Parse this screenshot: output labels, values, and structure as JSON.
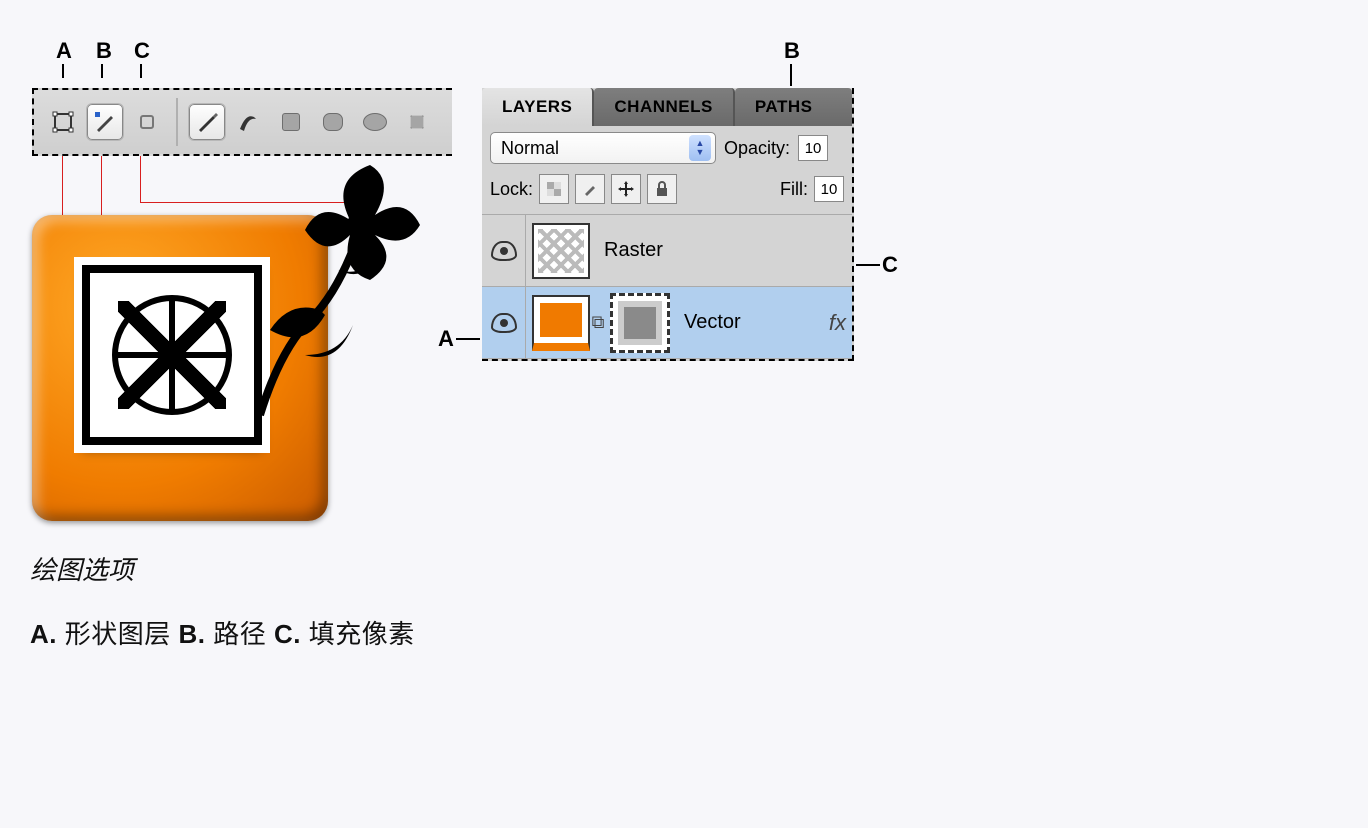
{
  "callouts": {
    "toolbar": {
      "a": "A",
      "b": "B",
      "c": "C"
    },
    "panel": {
      "a": "A",
      "b": "B",
      "c": "C"
    }
  },
  "toolbar": {
    "mode_a": "shape-layers-icon",
    "mode_b": "paths-icon",
    "mode_c": "fill-pixels-icon"
  },
  "panel": {
    "tabs": {
      "layers": "LAYERS",
      "channels": "CHANNELS",
      "paths": "PATHS"
    },
    "blend_mode": "Normal",
    "opacity_label": "Opacity:",
    "opacity_value": "10",
    "lock_label": "Lock:",
    "fill_label": "Fill:",
    "fill_value": "10",
    "layers": [
      {
        "name": "Raster",
        "selected": false,
        "kind": "raster"
      },
      {
        "name": "Vector",
        "selected": true,
        "kind": "vector",
        "has_fx": true,
        "fx_text": "fx"
      }
    ]
  },
  "captions": {
    "title": "绘图选项",
    "legend_a_key": "A.",
    "legend_a": "形状图层",
    "legend_b_key": "B.",
    "legend_b": "路径",
    "legend_c_key": "C.",
    "legend_c": "填充像素"
  }
}
